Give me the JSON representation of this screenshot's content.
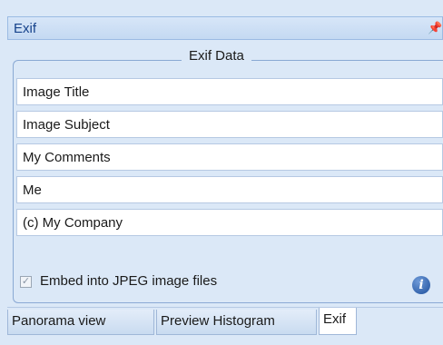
{
  "panel": {
    "title": "Exif",
    "pin_glyph": "₀"
  },
  "group": {
    "label": "Exif Data"
  },
  "fields": [
    {
      "value": "Image Title"
    },
    {
      "value": "Image Subject"
    },
    {
      "value": "My Comments"
    },
    {
      "value": "Me"
    },
    {
      "value": "(c) My Company"
    }
  ],
  "embed": {
    "label": "Embed into JPEG image files",
    "checked": true,
    "check_glyph": "✓"
  },
  "info_icon": {
    "glyph": "i",
    "icon": "info-icon"
  },
  "tabs": [
    {
      "label": "Panorama view"
    },
    {
      "label": "Preview Histogram"
    },
    {
      "label": "Exif"
    }
  ]
}
